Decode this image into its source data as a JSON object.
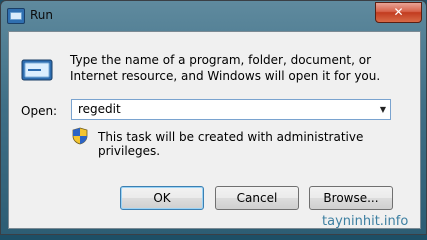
{
  "window": {
    "title": "Run",
    "close_glyph": "✕"
  },
  "dialog": {
    "instruction": "Type the name of a program, folder, document, or Internet resource, and Windows will open it for you.",
    "open_label": "Open:",
    "open_value": "regedit",
    "privilege_note": "This task will be created with administrative privileges."
  },
  "buttons": {
    "ok": "OK",
    "cancel": "Cancel",
    "browse": "Browse..."
  },
  "icons": {
    "title": "run-icon",
    "main": "run-icon",
    "shield": "uac-shield-icon",
    "dropdown": "chevron-down-icon"
  },
  "watermark": "tayninhit.info"
}
